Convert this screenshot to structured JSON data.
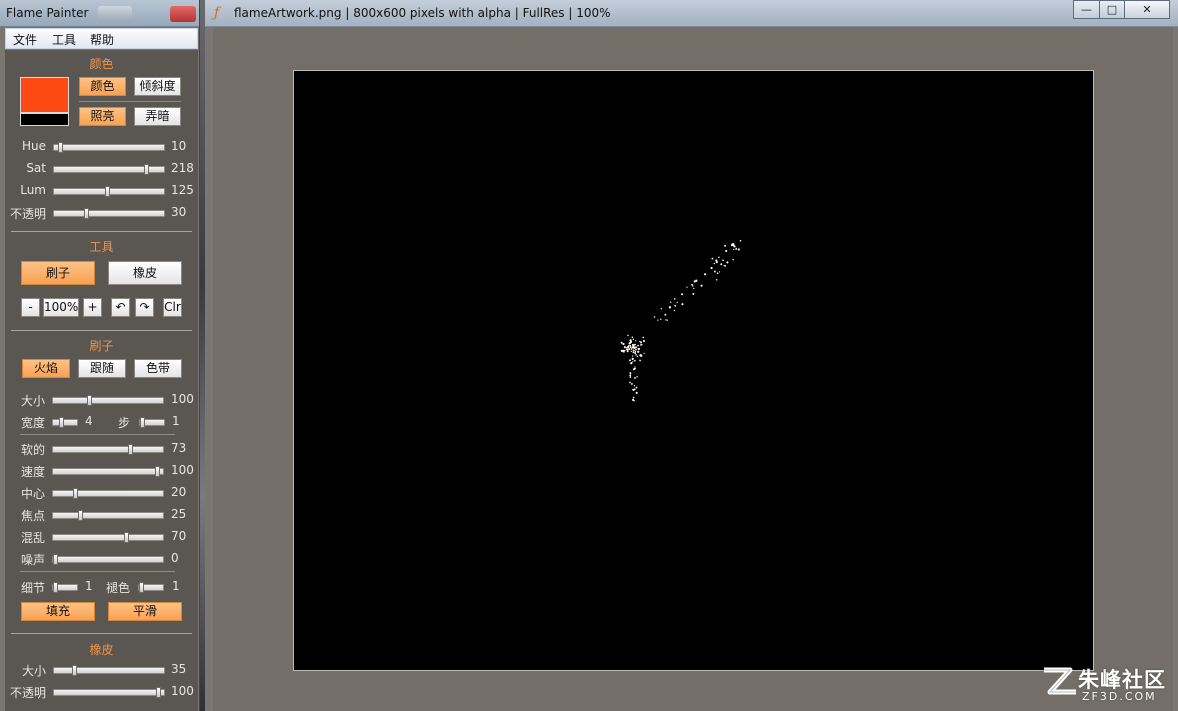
{
  "tool_window": {
    "title": "Flame Painter",
    "menu": [
      "文件",
      "工具",
      "帮助"
    ]
  },
  "color_section": {
    "title": "颜色",
    "primary_color": "#fd4a12",
    "secondary_color": "#000000",
    "btn_color": "颜色",
    "btn_gradient": "倾斜度",
    "btn_lighten": "照亮",
    "btn_darken": "弄暗",
    "sliders": [
      {
        "label": "Hue",
        "value": "10",
        "fraction": 0.04
      },
      {
        "label": "Sat",
        "value": "218",
        "fraction": 0.86
      },
      {
        "label": "Lum",
        "value": "125",
        "fraction": 0.49
      },
      {
        "label": "不透明",
        "value": "30",
        "fraction": 0.29
      }
    ]
  },
  "tool_section": {
    "title": "工具",
    "btn_brush": "刷子",
    "btn_eraser": "橡皮",
    "zoom_minus": "-",
    "zoom_value": "100%",
    "zoom_plus": "+",
    "undo": "↶",
    "redo": "↷",
    "clear": "Clr"
  },
  "brush_section": {
    "title": "刷子",
    "mode_flame": "火焰",
    "mode_follow": "跟随",
    "mode_ribbon": "色带",
    "size": {
      "label": "大小",
      "value": "100",
      "fraction": 0.32
    },
    "width": {
      "label": "宽度",
      "value": "4",
      "fraction": 0.3
    },
    "step": {
      "label": "步",
      "value": "1",
      "fraction": 0.0
    },
    "sliders": [
      {
        "label": "软的",
        "value": "73",
        "fraction": 0.71
      },
      {
        "label": "速度",
        "value": "100",
        "fraction": 0.97
      },
      {
        "label": "中心",
        "value": "20",
        "fraction": 0.19
      },
      {
        "label": "焦点",
        "value": "25",
        "fraction": 0.24
      },
      {
        "label": "混乱",
        "value": "70",
        "fraction": 0.68
      },
      {
        "label": "噪声",
        "value": "0",
        "fraction": 0.0
      }
    ],
    "detail": {
      "label": "细节",
      "value": "1",
      "fraction": 0.0
    },
    "fade": {
      "label": "褪色",
      "value": "1",
      "fraction": 0.0
    },
    "btn_fill": "填充",
    "btn_smooth": "平滑"
  },
  "eraser_section": {
    "title": "橡皮",
    "sliders": [
      {
        "label": "大小",
        "value": "35",
        "fraction": 0.17
      },
      {
        "label": "不透明",
        "value": "100",
        "fraction": 0.97
      }
    ]
  },
  "main_window": {
    "title": "flameArtwork.png | 800x600 pixels with alpha | FullRes | 100%",
    "ctrl_min": "—",
    "ctrl_max": "□",
    "ctrl_close": "✕"
  },
  "watermark": {
    "text": "朱峰社区",
    "sub": "ZF3D.COM"
  }
}
